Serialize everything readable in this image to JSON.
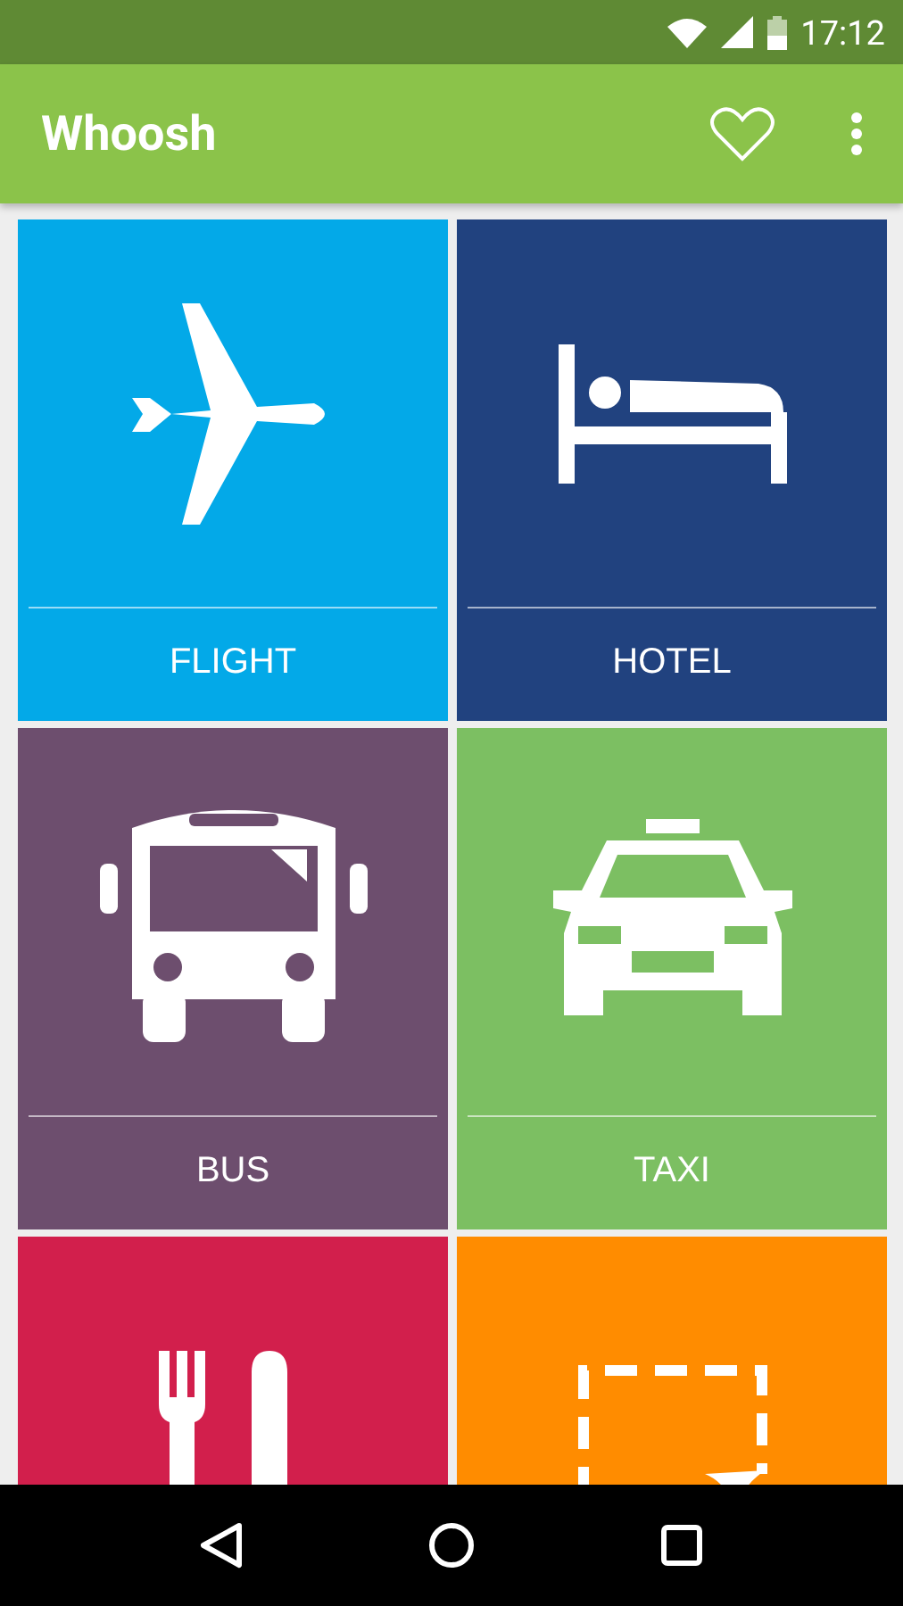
{
  "status_bar": {
    "time": "17:12"
  },
  "app_bar": {
    "title": "Whoosh"
  },
  "tiles": [
    {
      "kind": "plane",
      "label": "FLIGHT",
      "color": "#03a9e8"
    },
    {
      "kind": "bed",
      "label": "HOTEL",
      "color": "#21427f"
    },
    {
      "kind": "bus",
      "label": "BUS",
      "color": "#6d4e6e"
    },
    {
      "kind": "taxi",
      "label": "TAXI",
      "color": "#7cbf62"
    },
    {
      "kind": "cutlery",
      "color": "#d21f4c"
    },
    {
      "kind": "crop",
      "color": "#ff8c00"
    }
  ]
}
